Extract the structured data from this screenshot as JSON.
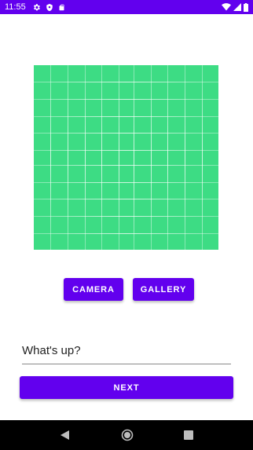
{
  "status_bar": {
    "time": "11:55",
    "left_icons": [
      "gear-icon",
      "shield-icon",
      "sd-card-icon"
    ],
    "right_icons": [
      "wifi-icon",
      "cell-signal-icon",
      "battery-icon"
    ],
    "background": "#6200ee"
  },
  "image_preview": {
    "color": "#3ddc84",
    "pattern": "grid-placeholder"
  },
  "buttons": {
    "camera_label": "CAMERA",
    "gallery_label": "GALLERY",
    "next_label": "NEXT"
  },
  "status_input": {
    "value": "What's up?"
  },
  "nav_bar": {
    "icons": [
      "back-icon",
      "home-icon",
      "recents-icon"
    ]
  },
  "colors": {
    "accent": "#6200ee",
    "preview_green": "#3ddc84"
  }
}
